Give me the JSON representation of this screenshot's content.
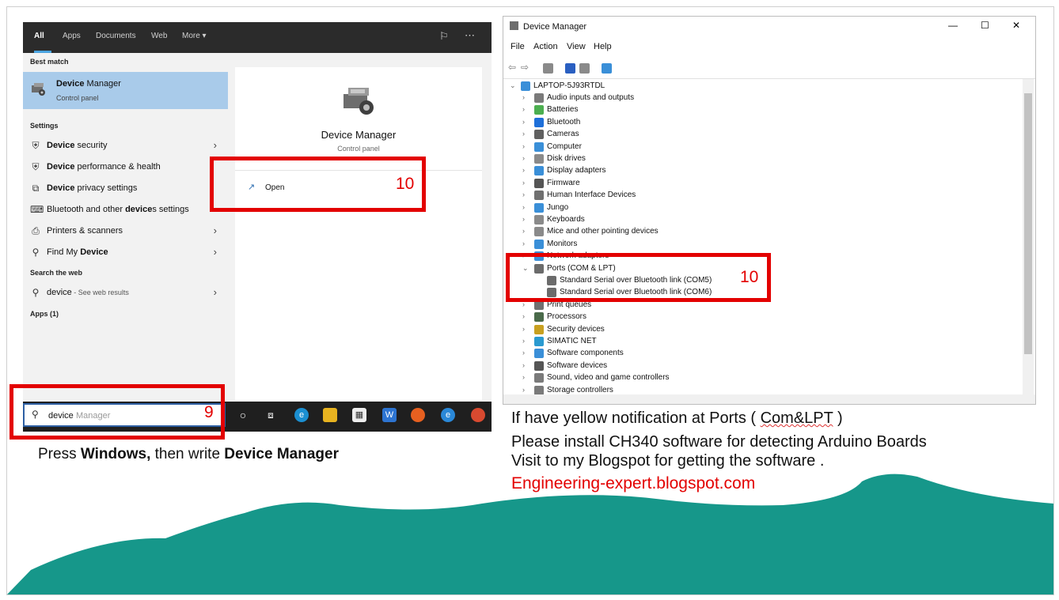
{
  "search": {
    "tabs": [
      "All",
      "Apps",
      "Documents",
      "Web",
      "More ▾"
    ],
    "best_match_header": "Best match",
    "best_match": {
      "bold": "Device",
      "rest": " Manager",
      "sub": "Control panel"
    },
    "settings_header": "Settings",
    "settings": [
      {
        "pre": "",
        "bold": "Device",
        "post": " security",
        "icon": "shield-icon",
        "glyph": "⛨",
        "chevron": true
      },
      {
        "pre": "",
        "bold": "Device",
        "post": " performance & health",
        "icon": "shield-icon",
        "glyph": "⛨",
        "chevron": false
      },
      {
        "pre": "",
        "bold": "Device",
        "post": " privacy settings",
        "icon": "privacy-icon",
        "glyph": "⧉",
        "chevron": false
      },
      {
        "pre": "Bluetooth and other ",
        "bold": "device",
        "post": "s settings",
        "icon": "bluetooth-devices-icon",
        "glyph": "⌨",
        "chevron": false
      },
      {
        "pre": "",
        "bold": "",
        "post": "Printers & scanners",
        "icon": "printer-icon",
        "glyph": "⎙",
        "chevron": true
      },
      {
        "pre": "Find My ",
        "bold": "Device",
        "post": "",
        "icon": "location-icon",
        "glyph": "⚲",
        "chevron": true
      }
    ],
    "web_header": "Search the web",
    "web_result": {
      "term": "device",
      "suffix": " - See web results"
    },
    "apps_header": "Apps (1)",
    "preview": {
      "title": "Device Manager",
      "subtitle": "Control panel",
      "open_label": "Open"
    },
    "query_typed": "device",
    "query_hint": "Manager"
  },
  "device_manager": {
    "title": "Device Manager",
    "menu": [
      "File",
      "Action",
      "View",
      "Help"
    ],
    "window_controls": [
      "—",
      "☐",
      "✕"
    ],
    "computer": "LAPTOP-5J93RTDL",
    "categories": [
      {
        "label": "Audio inputs and outputs",
        "color": "#7a7a7a"
      },
      {
        "label": "Batteries",
        "color": "#4caf50"
      },
      {
        "label": "Bluetooth",
        "color": "#1e6fd9"
      },
      {
        "label": "Cameras",
        "color": "#606060"
      },
      {
        "label": "Computer",
        "color": "#3a8fd8"
      },
      {
        "label": "Disk drives",
        "color": "#8a8a8a"
      },
      {
        "label": "Display adapters",
        "color": "#3a8fd8"
      },
      {
        "label": "Firmware",
        "color": "#555555"
      },
      {
        "label": "Human Interface Devices",
        "color": "#707070"
      },
      {
        "label": "Jungo",
        "color": "#3a8fd8"
      },
      {
        "label": "Keyboards",
        "color": "#8a8a8a"
      },
      {
        "label": "Mice and other pointing devices",
        "color": "#8a8a8a"
      },
      {
        "label": "Monitors",
        "color": "#3a8fd8"
      },
      {
        "label": "Network adapters",
        "color": "#3a8fd8"
      },
      {
        "label": "Ports (COM & LPT)",
        "color": "#6b6b6b",
        "expanded": true
      },
      {
        "label": "Print queues",
        "color": "#707070"
      },
      {
        "label": "Processors",
        "color": "#4a6a4a"
      },
      {
        "label": "Security devices",
        "color": "#c8a020"
      },
      {
        "label": "SIMATIC NET",
        "color": "#2a9ad0"
      },
      {
        "label": "Software components",
        "color": "#3a8fd8"
      },
      {
        "label": "Software devices",
        "color": "#555555"
      },
      {
        "label": "Sound, video and game controllers",
        "color": "#7a7a7a"
      },
      {
        "label": "Storage controllers",
        "color": "#7a7a7a"
      }
    ],
    "ports": [
      "Standard Serial over Bluetooth link (COM5)",
      "Standard Serial over Bluetooth link (COM6)"
    ]
  },
  "markers": {
    "step9": "9",
    "step10_open": "10",
    "step10_ports": "10"
  },
  "captions": {
    "press_pre": "Press ",
    "press_b1": "Windows,",
    "press_mid": " then write ",
    "press_b2": "Device Manager",
    "note1_pre": "If have yellow notification at Ports ( ",
    "note1_link": "Com&LPT",
    "note1_post": " )",
    "note2": "Please install CH340 software for detecting Arduino Boards",
    "note3": "Visit to my Blogspot for getting the software .",
    "blog": "Engineering-expert.blogspot.com"
  },
  "colors": {
    "accent_red": "#e30000",
    "wave_teal": "#16978a",
    "selection": "#a9cbea"
  }
}
